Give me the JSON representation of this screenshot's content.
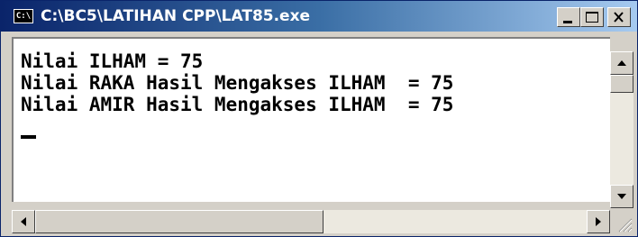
{
  "window": {
    "title": "C:\\BC5\\LATIHAN CPP\\LAT85.exe",
    "icon": "console-app-icon",
    "icon_text": "C:\\"
  },
  "console": {
    "lines": [
      "Nilai ILHAM = 75",
      "Nilai RAKA Hasil Mengakses ILHAM  = 75",
      "Nilai AMIR Hasil Mengakses ILHAM  = 75"
    ],
    "text_color": "#000000",
    "background": "#ffffff"
  },
  "controls": {
    "minimize": "minimize-icon",
    "maximize": "maximize-icon",
    "close": "close-icon"
  },
  "colors": {
    "titlebar_start": "#0a246a",
    "titlebar_end": "#a6caf0",
    "chrome": "#d4d0c8"
  }
}
